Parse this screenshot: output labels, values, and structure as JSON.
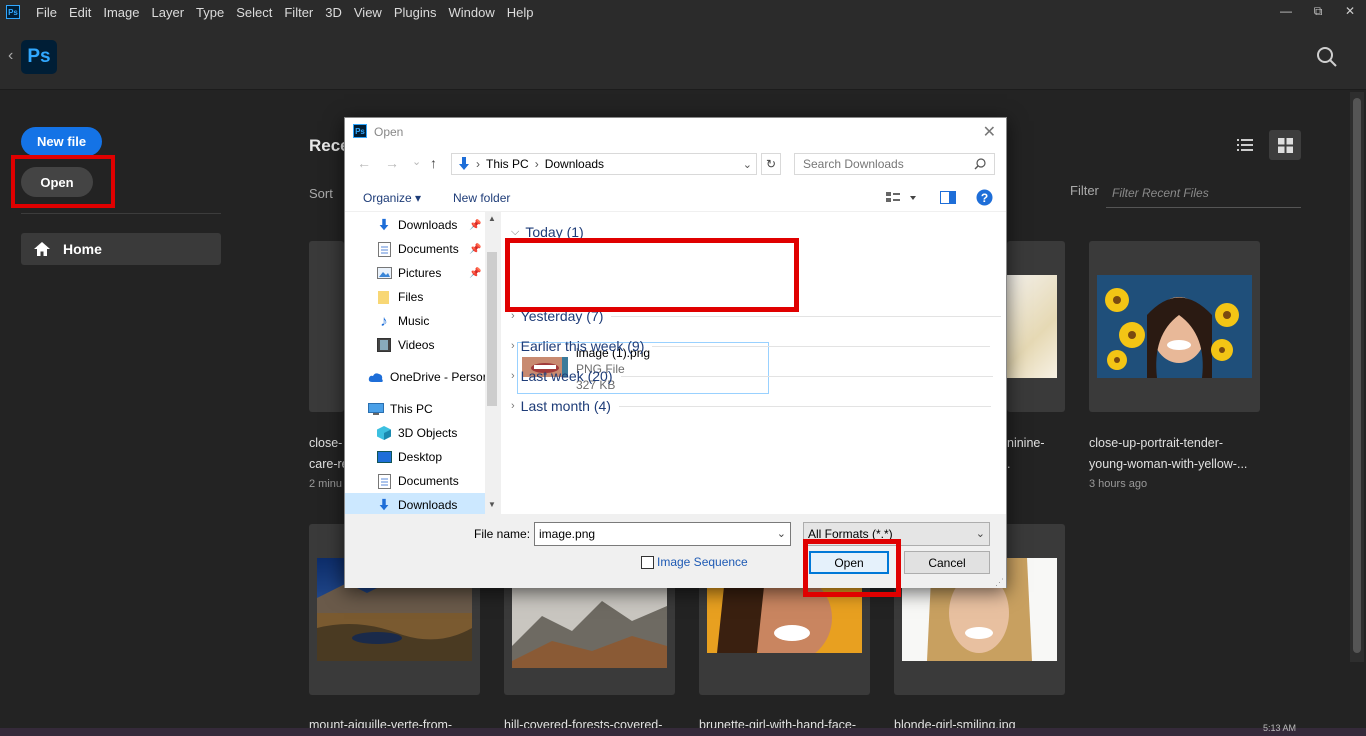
{
  "menubar": {
    "app_icon": "Ps",
    "items": [
      "File",
      "Edit",
      "Image",
      "Layer",
      "Type",
      "Select",
      "Filter",
      "3D",
      "View",
      "Plugins",
      "Window",
      "Help"
    ],
    "window_controls": [
      "—",
      "⧉",
      "✕"
    ]
  },
  "header": {
    "logo": "Ps"
  },
  "sidebar": {
    "new_file": "New file",
    "open": "Open",
    "home": "Home"
  },
  "main": {
    "recent_title": "Rece",
    "sort_label": "Sort",
    "filter_label": "Filter",
    "filter_placeholder": "Filter Recent Files",
    "cards": [
      {
        "title_l1": "close-",
        "title_l2": "care-re",
        "time": "2 minu"
      },
      {
        "title_l1": "",
        "title_l2": "",
        "time": ""
      },
      {
        "title_l1": "ninine-",
        "title_l2": ".",
        "time": ""
      },
      {
        "title_l1": "close-up-portrait-tender-",
        "title_l2": "young-woman-with-yellow-...",
        "time": "3 hours ago"
      },
      {
        "title_l1": "mount-aiguille-verte-from-",
        "title_l2": "",
        "time": ""
      },
      {
        "title_l1": "hill-covered-forests-covered-",
        "title_l2": "",
        "time": ""
      },
      {
        "title_l1": "brunette-girl-with-hand-face-",
        "title_l2": "",
        "time": ""
      },
      {
        "title_l1": "blonde-girl-smiling.jpg",
        "title_l2": "",
        "time": ""
      }
    ]
  },
  "taskbar": {
    "clock": "5:13 AM"
  },
  "dialog": {
    "title": "Open",
    "icon": "Ps",
    "address": {
      "root": "This PC",
      "sep": "›",
      "folder": "Downloads"
    },
    "search_placeholder": "Search Downloads",
    "toolbar": {
      "organize": "Organize ▾",
      "new_folder": "New folder"
    },
    "nav_items": [
      {
        "label": "Downloads",
        "icon": "download-arrow-icon",
        "pinned": true
      },
      {
        "label": "Documents",
        "icon": "document-icon",
        "pinned": true
      },
      {
        "label": "Pictures",
        "icon": "pictures-icon",
        "pinned": true
      },
      {
        "label": "Files",
        "icon": "folder-icon",
        "pinned": false
      },
      {
        "label": "Music",
        "icon": "music-note-icon",
        "pinned": false
      },
      {
        "label": "Videos",
        "icon": "video-icon",
        "pinned": false
      },
      {
        "label": "OneDrive - Persor",
        "icon": "cloud-icon",
        "pinned": false
      },
      {
        "label": "This PC",
        "icon": "computer-icon",
        "pinned": false
      },
      {
        "label": "3D Objects",
        "icon": "cube-icon",
        "pinned": false
      },
      {
        "label": "Desktop",
        "icon": "desktop-icon",
        "pinned": false
      },
      {
        "label": "Documents",
        "icon": "document-icon",
        "pinned": false
      },
      {
        "label": "Downloads",
        "icon": "download-arrow-icon",
        "pinned": false
      }
    ],
    "groups": [
      {
        "label": "Today (1)",
        "expanded": true
      },
      {
        "label": "Yesterday (7)",
        "expanded": false
      },
      {
        "label": "Earlier this week (9)",
        "expanded": false
      },
      {
        "label": "Last week (20)",
        "expanded": false
      },
      {
        "label": "Last month (4)",
        "expanded": false
      }
    ],
    "file": {
      "name": "image (1).png",
      "type": "PNG File",
      "size": "327 KB"
    },
    "file_name_label": "File name:",
    "file_name_value": "image.png",
    "format": "All Formats (*.*)",
    "image_sequence": "Image Sequence",
    "open": "Open",
    "cancel": "Cancel"
  },
  "colors": {
    "accent": "#1473e6",
    "highlight": "#e00000",
    "ps_blue": "#31a8ff"
  }
}
